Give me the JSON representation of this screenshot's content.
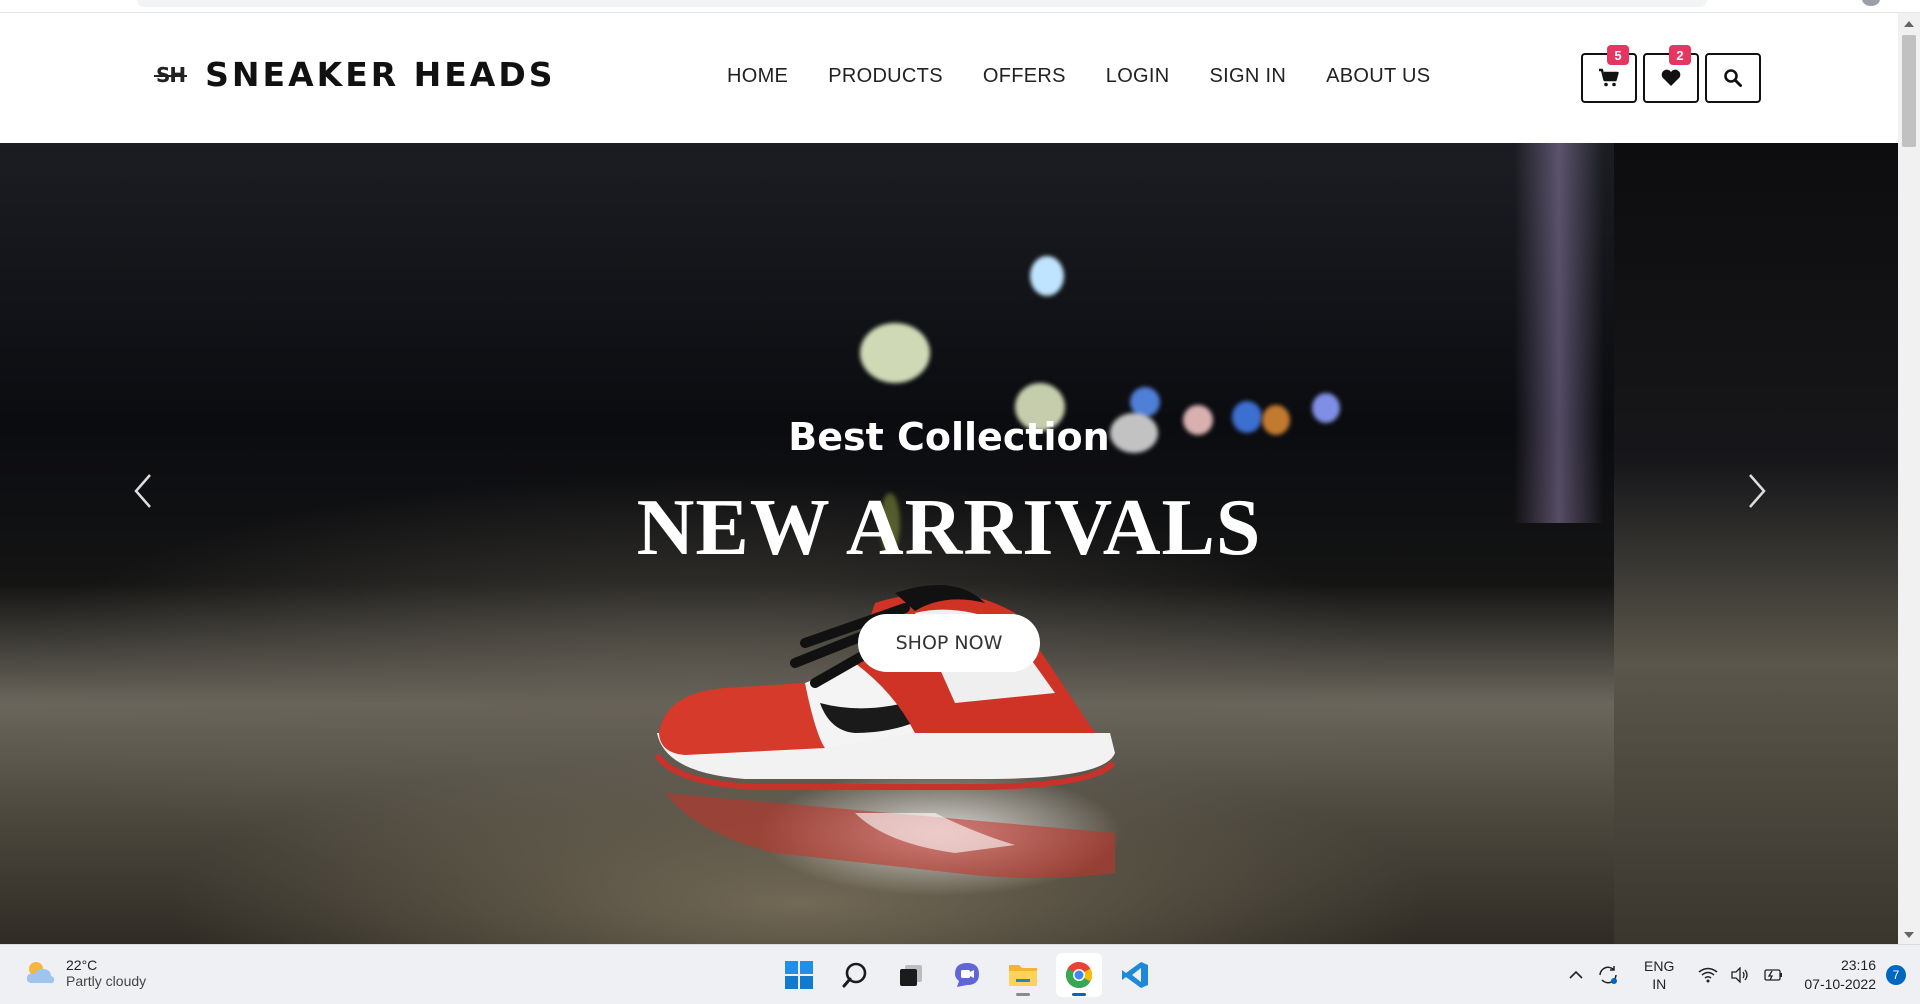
{
  "site": {
    "logo_mark": "SH",
    "logo_text": "SNEAKER HEADS",
    "nav": [
      "HOME",
      "PRODUCTS",
      "OFFERS",
      "LOGIN",
      "SIGN IN",
      "ABOUT US"
    ],
    "cart_count": "5",
    "wishlist_count": "2",
    "accent_color": "#e53560"
  },
  "hero": {
    "subtitle": "Best Collection",
    "title": "NEW ARRIVALS",
    "button": "SHOP NOW"
  },
  "taskbar": {
    "weather_temp": "22°C",
    "weather_condition": "Partly cloudy",
    "lang_line1": "ENG",
    "lang_line2": "IN",
    "time": "23:16",
    "date": "07-10-2022",
    "notification_count": "7",
    "apps": [
      "start-icon",
      "search-icon",
      "task-view-icon",
      "teams-chat-icon",
      "file-explorer-icon",
      "chrome-icon",
      "vscode-icon"
    ]
  }
}
